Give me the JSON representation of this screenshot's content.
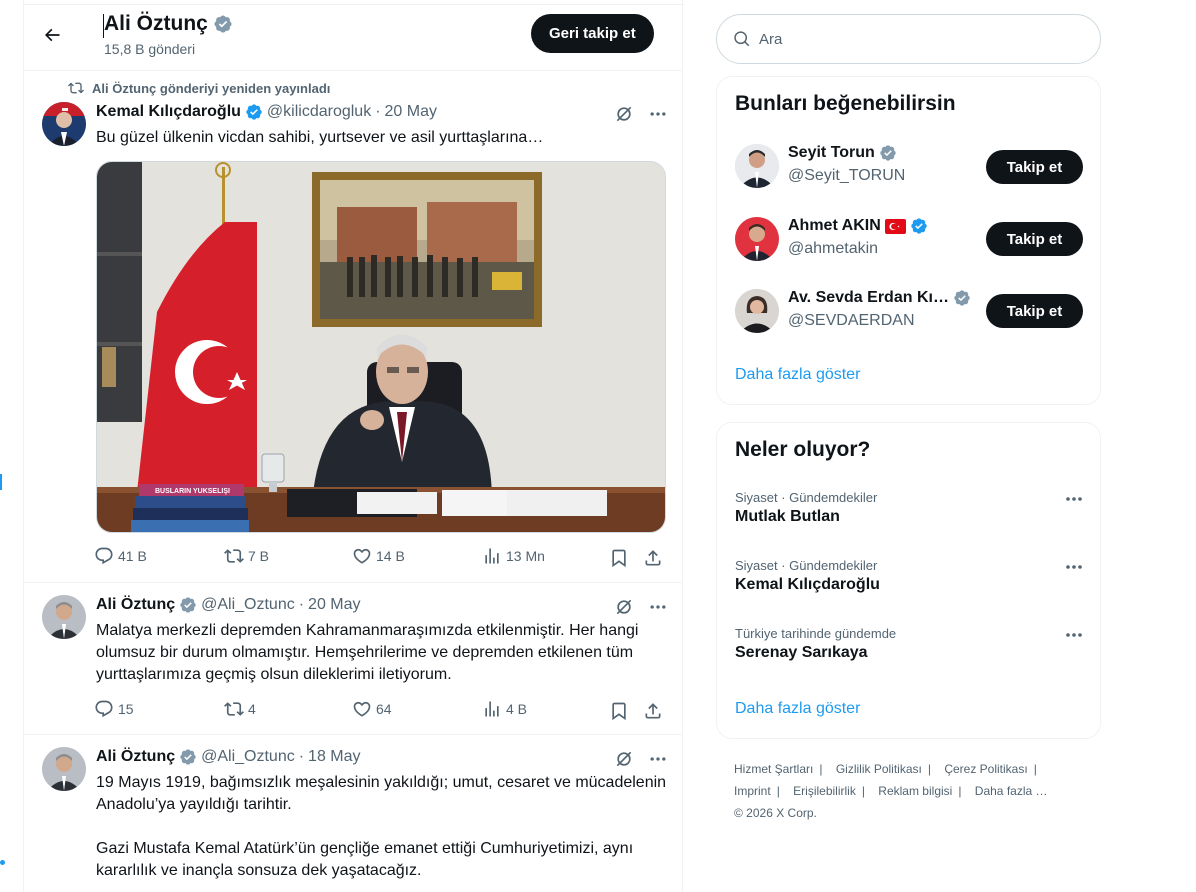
{
  "header": {
    "name": "Ali Öztunç",
    "post_count": "15,8 B gönderi",
    "follow_back_label": "Geri takip et"
  },
  "repost_note": "Ali Öztunç gönderiyi yeniden yayınladı",
  "tweets": [
    {
      "name": "Kemal Kılıçdaroğlu",
      "handle": "@kilicdarogluk",
      "date": "20 May",
      "text": "Bu güzel ülkenin vicdan sahibi, yurtsever ve asil yurttaşlarına…",
      "replies": "41 B",
      "reposts": "7 B",
      "likes": "14 B",
      "views": "13 Mn",
      "media_book_label": "BUSLARIN YUKSELIŞI"
    },
    {
      "name": "Ali Öztunç",
      "handle": "@Ali_Oztunc",
      "date": "20 May",
      "text": "Malatya merkezli depremden Kahramanmaraşımızda etkilenmiştir. Her hangi olumsuz bir durum olmamıştır. Hemşehrilerime ve depremden etkilenen tüm yurttaşlarımıza geçmiş olsun dileklerimi iletiyorum.",
      "replies": "15",
      "reposts": "4",
      "likes": "64",
      "views": "4 B"
    },
    {
      "name": "Ali Öztunç",
      "handle": "@Ali_Oztunc",
      "date": "18 May",
      "text_p1": "19 Mayıs 1919, bağımsızlık meşalesinin yakıldığı; umut, cesaret ve mücadelenin Anadolu’ya yayıldığı tarihtir.",
      "text_p2": "Gazi Mustafa Kemal Atatürk’ün gençliğe emanet ettiği Cumhuriyetimizi, aynı kararlılık ve inançla sonsuza dek yaşatacağız."
    }
  ],
  "search": {
    "placeholder": "Ara"
  },
  "who_to_follow": {
    "title": "Bunları beğenebilirsin",
    "users": [
      {
        "name": "Seyit Torun",
        "handle": "@Seyit_TORUN",
        "button": "Takip et",
        "verified_color": "#829aab"
      },
      {
        "name": "Ahmet AKIN",
        "handle": "@ahmetakin",
        "button": "Takip et",
        "verified_color": "#1d9bf0"
      },
      {
        "name": "Av. Sevda Erdan Kı…",
        "handle": "@SEVDAERDAN",
        "button": "Takip et",
        "verified_color": "#829aab"
      }
    ],
    "show_more": "Daha fazla göster"
  },
  "trends": {
    "title": "Neler oluyor?",
    "items": [
      {
        "category": "Siyaset · Gündemdekiler",
        "title": "Mutlak Butlan"
      },
      {
        "category": "Siyaset · Gündemdekiler",
        "title": "Kemal Kılıçdaroğlu"
      },
      {
        "category": "Türkiye tarihinde gündemde",
        "title": "Serenay Sarıkaya"
      }
    ],
    "show_more": "Daha fazla göster"
  },
  "footer": {
    "links": [
      "Hizmet Şartları",
      "Gizlilik Politikası",
      "Çerez Politikası",
      "Imprint",
      "Erişilebilirlik",
      "Reklam bilgisi",
      "Daha fazla …"
    ],
    "copyright": "© 2026 X Corp."
  },
  "colors": {
    "accent": "#1d9bf0",
    "text": "#0f1419",
    "muted": "#536471",
    "button_dark": "#0f1419",
    "gray_verified": "#829aab"
  }
}
